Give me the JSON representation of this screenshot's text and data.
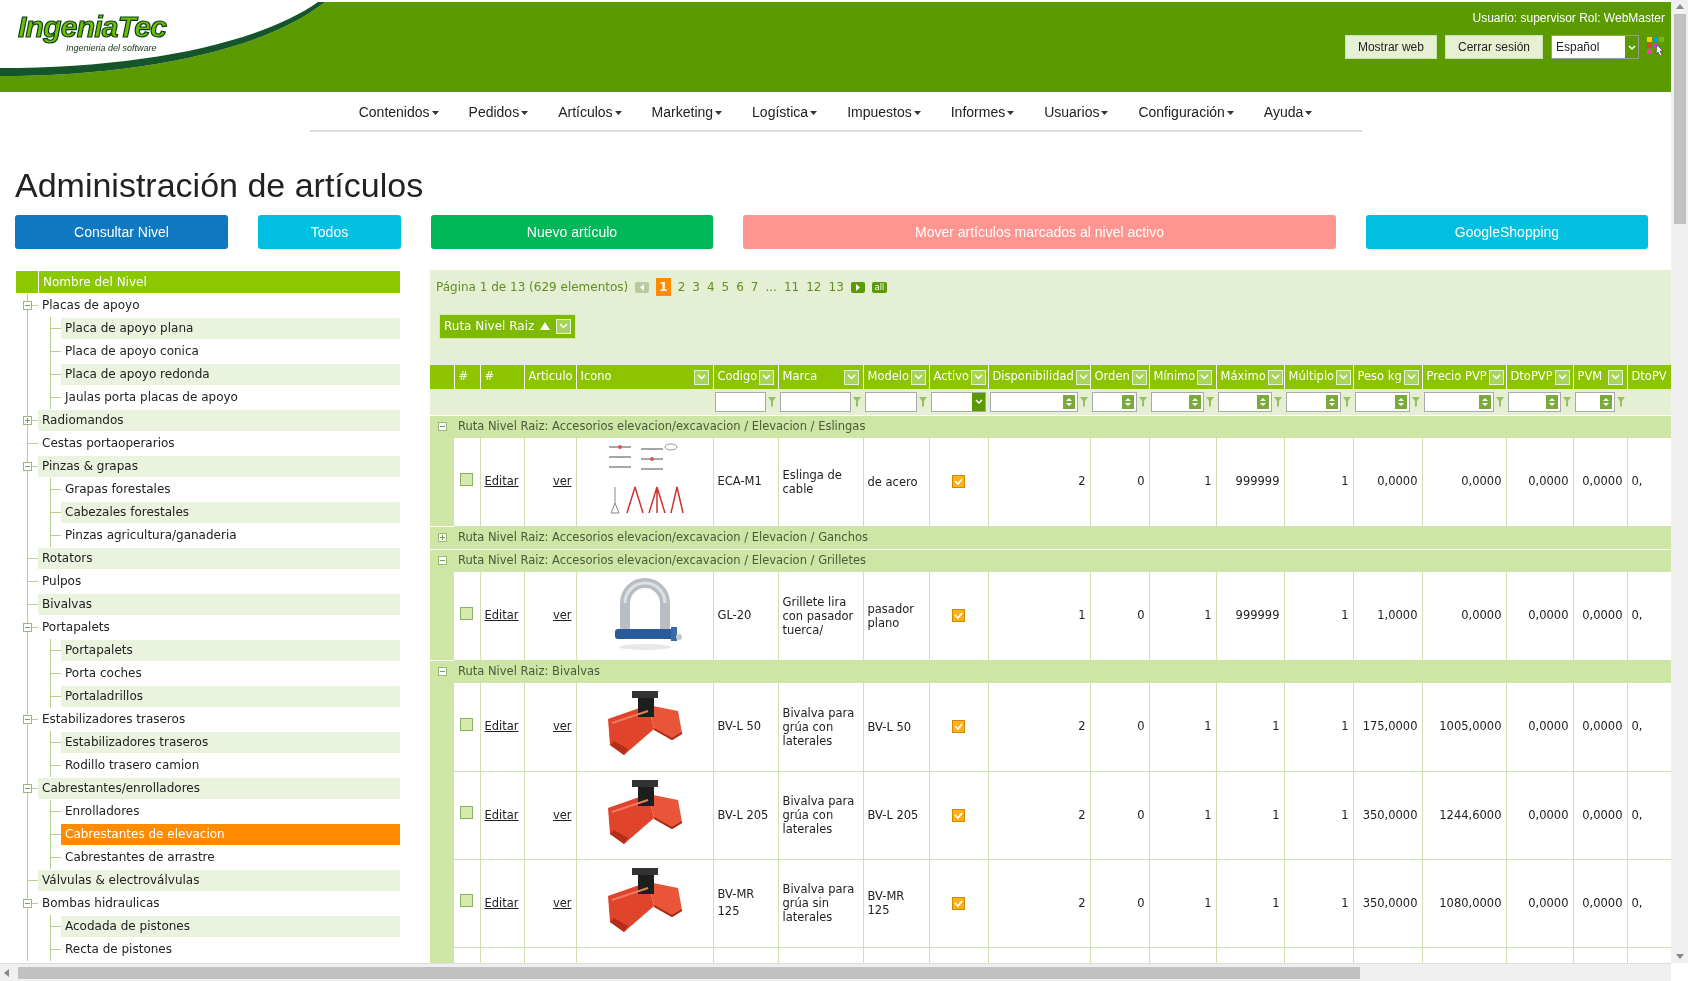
{
  "header": {
    "logo": "IngeniaTec",
    "tagline": "Ingenieria del software",
    "user_info": "Usuario: supervisor Rol: WebMaster",
    "buttons": [
      "Mostrar web",
      "Cerrar sesión"
    ],
    "language": "Español"
  },
  "nav": [
    "Contenidos",
    "Pedidos",
    "Artículos",
    "Marketing",
    "Logística",
    "Impuestos",
    "Informes",
    "Usuarios",
    "Configuración",
    "Ayuda"
  ],
  "title": "Administración de artículos",
  "actions": [
    {
      "label": "Consultar Nivel",
      "color": "#0e78c0"
    },
    {
      "label": "Todos",
      "color": "#00bfe0"
    },
    {
      "label": "Nuevo artículo",
      "color": "#00b85a"
    },
    {
      "label": "Mover artículos marcados al nivel activo",
      "color": "#ff9490"
    },
    {
      "label": "GoogleShopping",
      "color": "#00bfe0"
    }
  ],
  "tree": {
    "heading": "Nombre del Nivel",
    "items": [
      {
        "label": "Placas de apoyo",
        "expanded": true,
        "selected": false,
        "children": [
          {
            "label": "Placa de apoyo plana",
            "selected": false
          },
          {
            "label": "Placa de apoyo conica",
            "selected": false
          },
          {
            "label": "Placa de apoyo redonda",
            "selected": false
          },
          {
            "label": "Jaulas porta placas de apoyo",
            "selected": false
          }
        ]
      },
      {
        "label": "Radiomandos",
        "expanded": false,
        "selected": false
      },
      {
        "label": "Cestas portaoperarios",
        "selected": false
      },
      {
        "label": "Pinzas & grapas",
        "expanded": true,
        "selected": false,
        "children": [
          {
            "label": "Grapas forestales",
            "selected": false
          },
          {
            "label": "Cabezales forestales",
            "selected": false
          },
          {
            "label": "Pinzas agricultura/ganaderia",
            "selected": false
          }
        ]
      },
      {
        "label": "Rotators",
        "selected": false
      },
      {
        "label": "Pulpos",
        "selected": false
      },
      {
        "label": "Bivalvas",
        "selected": false
      },
      {
        "label": "Portapalets",
        "expanded": true,
        "selected": false,
        "children": [
          {
            "label": "Portapalets",
            "selected": false
          },
          {
            "label": "Porta coches",
            "selected": false
          },
          {
            "label": "Portaladrillos",
            "selected": false
          }
        ]
      },
      {
        "label": "Estabilizadores traseros",
        "expanded": true,
        "selected": false,
        "children": [
          {
            "label": "Estabilizadores traseros",
            "selected": false
          },
          {
            "label": "Rodillo trasero camion",
            "selected": false
          }
        ]
      },
      {
        "label": "Cabrestantes/enrolladores",
        "expanded": true,
        "selected": false,
        "children": [
          {
            "label": "Enrolladores",
            "selected": false
          },
          {
            "label": "Cabrestantes de elevacion",
            "selected": true
          },
          {
            "label": "Cabrestantes de arrastre",
            "selected": false
          }
        ]
      },
      {
        "label": "Válvulas & electroválvulas",
        "selected": false
      },
      {
        "label": "Bombas hidraulicas",
        "expanded": true,
        "selected": false,
        "children": [
          {
            "label": "Acodada de pistones",
            "selected": false
          },
          {
            "label": "Recta de pistones",
            "selected": false
          }
        ]
      }
    ]
  },
  "pager": {
    "summary": "Página 1 de 13 (629 elementos)",
    "pages": [
      {
        "label": "1",
        "selected": true
      },
      {
        "label": "2",
        "selected": false
      },
      {
        "label": "3",
        "selected": false
      },
      {
        "label": "4",
        "selected": false
      },
      {
        "label": "5",
        "selected": false
      },
      {
        "label": "6",
        "selected": false
      },
      {
        "label": "7",
        "selected": false
      },
      {
        "label": "...",
        "selected": false
      },
      {
        "label": "11",
        "selected": false
      },
      {
        "label": "12",
        "selected": false
      },
      {
        "label": "13",
        "selected": false
      }
    ],
    "all": "all"
  },
  "group_by": "Ruta Nivel Raiz",
  "columns": [
    {
      "label": "#",
      "kind": "none",
      "menu": false
    },
    {
      "label": "#",
      "kind": "none",
      "menu": false
    },
    {
      "label": "Articulo",
      "kind": "none",
      "menu": false
    },
    {
      "label": "Icono",
      "kind": "none",
      "menu": true
    },
    {
      "label": "Codigo",
      "kind": "text",
      "menu": true
    },
    {
      "label": "Marca",
      "kind": "text",
      "menu": true
    },
    {
      "label": "Modelo",
      "kind": "text",
      "menu": true
    },
    {
      "label": "Activo",
      "kind": "select",
      "menu": true
    },
    {
      "label": "Disponibilidad",
      "kind": "number",
      "menu": true
    },
    {
      "label": "Orden",
      "kind": "number",
      "menu": true
    },
    {
      "label": "Mínimo",
      "kind": "number",
      "menu": true
    },
    {
      "label": "Máximo",
      "kind": "number",
      "menu": true
    },
    {
      "label": "Múltiplo",
      "kind": "number",
      "menu": true
    },
    {
      "label": "Peso kg",
      "kind": "number",
      "menu": true
    },
    {
      "label": "Precio PVP",
      "kind": "number",
      "menu": true
    },
    {
      "label": "DtoPVP",
      "kind": "number",
      "menu": true
    },
    {
      "label": "PVM",
      "kind": "number",
      "menu": true
    },
    {
      "label": "DtoPV",
      "kind": "none",
      "menu": false
    }
  ],
  "groups": [
    {
      "label": "Ruta Nivel Raiz: Accesorios elevacion/excavacion / Elevacion / Eslingas",
      "expanded": true,
      "rows": [
        {
          "checked": false,
          "edit": "Editar",
          "view": "ver",
          "codigo": "ECA-M1",
          "marca": "Eslinga de cable",
          "modelo": "de acero",
          "active": true,
          "values": [
            "2",
            "0",
            "1",
            "999999",
            "1",
            "0,0000",
            "0,0000",
            "0,0000",
            "0,0000",
            "0,"
          ]
        }
      ]
    },
    {
      "label": "Ruta Nivel Raiz: Accesorios elevacion/excavacion / Elevacion / Ganchos",
      "expanded": false
    },
    {
      "label": "Ruta Nivel Raiz: Accesorios elevacion/excavacion / Elevacion / Grilletes",
      "expanded": true,
      "rows": [
        {
          "checked": false,
          "edit": "Editar",
          "view": "ver",
          "codigo": "GL-20",
          "marca": "Grillete lira con pasador tuerca/",
          "modelo": "pasador plano",
          "active": true,
          "values": [
            "1",
            "0",
            "1",
            "999999",
            "1",
            "1,0000",
            "0,0000",
            "0,0000",
            "0,0000",
            "0,"
          ]
        }
      ]
    },
    {
      "label": "Ruta Nivel Raiz: Bivalvas",
      "expanded": true,
      "rows": [
        {
          "checked": false,
          "edit": "Editar",
          "view": "ver",
          "codigo": "BV-L 50",
          "marca": "Bivalva para grúa con laterales",
          "modelo": "BV-L 50",
          "active": true,
          "values": [
            "2",
            "0",
            "1",
            "1",
            "1",
            "175,0000",
            "1005,0000",
            "0,0000",
            "0,0000",
            "0,"
          ]
        },
        {
          "checked": false,
          "edit": "Editar",
          "view": "ver",
          "codigo": "BV-L 205",
          "marca": "Bivalva para grúa con laterales",
          "modelo": "BV-L 205",
          "active": true,
          "values": [
            "2",
            "0",
            "1",
            "1",
            "1",
            "350,0000",
            "1244,6000",
            "0,0000",
            "0,0000",
            "0,"
          ]
        },
        {
          "checked": false,
          "edit": "Editar",
          "view": "ver",
          "codigo": "BV-MR 125",
          "marca": "Bivalva para grúa sin laterales",
          "modelo": "BV-MR 125",
          "active": true,
          "values": [
            "2",
            "0",
            "1",
            "1",
            "1",
            "350,0000",
            "1080,0000",
            "0,0000",
            "0,0000",
            "0,"
          ]
        }
      ]
    }
  ]
}
